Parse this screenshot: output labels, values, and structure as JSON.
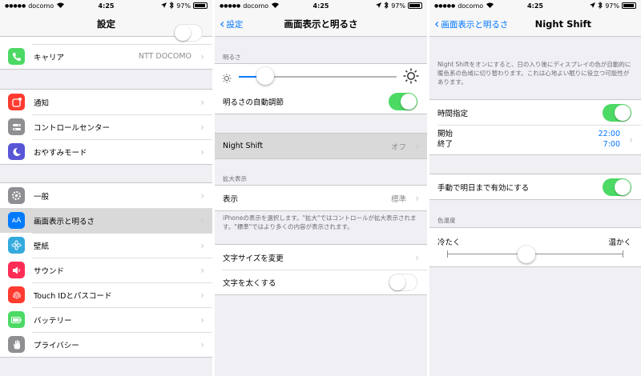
{
  "status": {
    "carrier": "docomo",
    "time": "4:25",
    "battery": "97%"
  },
  "panel1": {
    "title": "設定",
    "groups": [
      {
        "items": [
          {
            "label": "キャリア",
            "detail": "NTT DOCOMO",
            "icon": "phone-icon",
            "color": "#4cd964"
          }
        ]
      },
      {
        "items": [
          {
            "label": "通知",
            "icon": "notification-icon",
            "color": "#ff3b30"
          },
          {
            "label": "コントロールセンター",
            "icon": "switches-icon",
            "color": "#8e8e93"
          },
          {
            "label": "おやすみモード",
            "icon": "moon-icon",
            "color": "#5856d6"
          }
        ]
      },
      {
        "items": [
          {
            "label": "一般",
            "icon": "gear-icon",
            "color": "#8e8e93"
          },
          {
            "label": "画面表示と明るさ",
            "icon": "text-size-icon",
            "color": "#007aff",
            "selected": true
          },
          {
            "label": "壁紙",
            "icon": "flower-icon",
            "color": "#34aadc"
          },
          {
            "label": "サウンド",
            "icon": "speaker-icon",
            "color": "#ff2d55"
          },
          {
            "label": "Touch IDとパスコード",
            "icon": "fingerprint-icon",
            "color": "#ff3b30"
          },
          {
            "label": "バッテリー",
            "icon": "battery-icon",
            "color": "#4cd964"
          },
          {
            "label": "プライバシー",
            "icon": "hand-icon",
            "color": "#8e8e93"
          }
        ]
      }
    ]
  },
  "panel2": {
    "back": "設定",
    "title": "画面表示と明るさ",
    "brightness_header": "明るさ",
    "brightness_level": 0.17,
    "auto_brightness": "明るさの自動調節",
    "auto_brightness_on": true,
    "night_shift": "Night Shift",
    "night_shift_value": "オフ",
    "zoom_header": "拡大表示",
    "display_label": "表示",
    "display_value": "標準",
    "zoom_footer": "iPhoneの表示を選択します。\"拡大\"ではコントロールが拡大表示されます。\"標準\"ではより多くの内容が表示されます。",
    "text_size": "文字サイズを変更",
    "bold_text": "文字を太くする",
    "bold_text_on": false
  },
  "panel3": {
    "back": "画面表示と明るさ",
    "title": "Night Shift",
    "description": "Night Shiftをオンにすると、日の入り後にディスプレイの色が自動的に暖色系の色域に切り替わります。これは心地よい眠りに役立つ可能性があります。",
    "scheduled": "時間指定",
    "scheduled_on": true,
    "start_label": "開始",
    "end_label": "終了",
    "start_time": "22:00",
    "end_time": "7:00",
    "manual": "手動で明日まで有効にする",
    "manual_on": true,
    "temp_header": "色温度",
    "less_warm": "冷たく",
    "more_warm": "温かく",
    "temp_level": 0.45
  }
}
